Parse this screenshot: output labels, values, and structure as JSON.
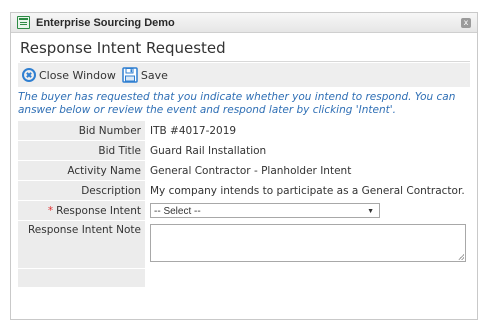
{
  "window": {
    "title": "Enterprise Sourcing Demo",
    "close_glyph": "x"
  },
  "page": {
    "title": "Response Intent Requested"
  },
  "toolbar": {
    "close_label": "Close Window",
    "save_label": "Save"
  },
  "instructions": "The buyer has requested that you indicate whether you intend to respond. You can answer below or review the event and respond later by clicking 'Intent'.",
  "form": {
    "rows": [
      {
        "label": "Bid Number",
        "value": "ITB #4017-2019"
      },
      {
        "label": "Bid Title",
        "value": "Guard Rail Installation"
      },
      {
        "label": "Activity Name",
        "value": "General Contractor - Planholder Intent"
      },
      {
        "label": "Description",
        "value": "My company intends to participate as a General Contractor."
      }
    ],
    "response_intent": {
      "required_marker": "*",
      "label": "Response Intent",
      "selected": "-- Select --"
    },
    "note": {
      "label": "Response Intent Note",
      "value": ""
    }
  },
  "colors": {
    "link_blue": "#2f6fb5",
    "icon_blue": "#2f7fd1",
    "required_red": "#e03030",
    "label_bg": "#ececec"
  }
}
